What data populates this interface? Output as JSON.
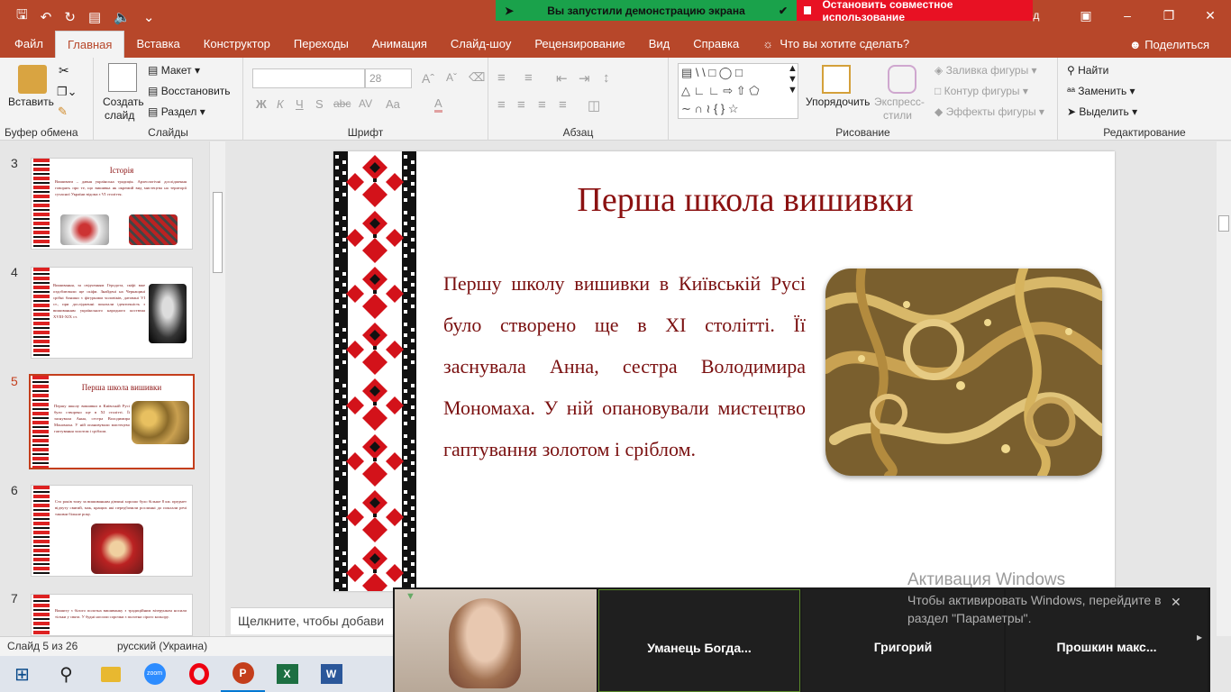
{
  "titlebar": {
    "share_banner": "Вы запустили демонстрацию экрана",
    "stop_share": "Остановить совместное использование",
    "partial_text": "од"
  },
  "tabs": [
    {
      "label": "Файл"
    },
    {
      "label": "Главная",
      "active": true
    },
    {
      "label": "Вставка"
    },
    {
      "label": "Конструктор"
    },
    {
      "label": "Переходы"
    },
    {
      "label": "Анимация"
    },
    {
      "label": "Слайд-шоу"
    },
    {
      "label": "Рецензирование"
    },
    {
      "label": "Вид"
    },
    {
      "label": "Справка"
    }
  ],
  "tell_me": "Что вы хотите сделать?",
  "share_label": "Поделиться",
  "ribbon": {
    "clipboard": {
      "paste": "Вставить",
      "group": "Буфер обмена"
    },
    "slides": {
      "new_slide_1": "Создать",
      "new_slide_2": "слайд",
      "layout": "Макет",
      "reset": "Восстановить",
      "section": "Раздел",
      "group": "Слайды"
    },
    "font": {
      "size": "28",
      "group": "Шрифт",
      "bold": "Ж",
      "italic": "К",
      "underline": "Ч",
      "strike": "S",
      "spacing": "AV",
      "case": "Aa",
      "color": "A"
    },
    "paragraph": {
      "group": "Абзац"
    },
    "drawing": {
      "arrange": "Упорядочить",
      "quick_styles_1": "Экспресс-",
      "quick_styles_2": "стили",
      "fill": "Заливка фигуры",
      "outline": "Контур фигуры",
      "effects": "Эффекты фигуры",
      "group": "Рисование"
    },
    "editing": {
      "find": "Найти",
      "replace": "Заменить",
      "select": "Выделить",
      "group": "Редактирование"
    }
  },
  "thumbnails": [
    {
      "num": "3",
      "title": "Історія",
      "text": "Вишивати – давня українська традиція. Археологічні дослідження говорять про те, що вишивка як окремий вид мистецтва на території сучасної України відома з VI століття."
    },
    {
      "num": "4",
      "title": "",
      "text": "Вишивання, за свідченням Геродота, скіфі вже оздоблювали ще скіфи. Знайдені на Черкащині срібні бляшки з фігурками чоловіків, датовані VI ст., при дослідженні показали ідентичність з вишиванням українського народного костюма XVIII-XIX ст."
    },
    {
      "num": "5",
      "title": "Перша школа вишивки",
      "text": "Першу школу вишивки в Київській Русі було створено ще в XI столітті. Її заснувала Анна, сестра Володимира Мономаха. У ній опановували мистецтво гаптування золотом і сріблом.",
      "selected": true
    },
    {
      "num": "6",
      "title": "",
      "text": "Сто років тому за вишиванням дівчині хорошо було більше 8 км. предмет відчуту святий, мак, кращих які передбачили рослинні до поклали речі такими більше року."
    },
    {
      "num": "7",
      "title": "",
      "text": "Вишиту з білого полотна вишиванку з традиційним візерунком носили тільки у свята. У будні носили сорочки з полотна сірого кольору."
    }
  ],
  "slide": {
    "title": "Перша школа вишивки",
    "body": "Першу школу вишивки в Київській Русі було створено ще в XI столітті. Її заснувала Анна, сестра Володимира Мономаха. У ній опановували мистецтво гаптування золотом і сріблом."
  },
  "notes_placeholder": "Щелкните, чтобы добави",
  "activation": {
    "title": "Активация Windows",
    "text": "Чтобы активировать Windows, перейдите в раздел \"Параметры\"."
  },
  "status": {
    "slide": "Слайд 5 из 26",
    "language": "русский (Украина)"
  },
  "zoom_tiles": [
    {
      "name": ""
    },
    {
      "name": "Уманець Богда..."
    },
    {
      "name": "Григорий"
    },
    {
      "name": "Прошкин макс..."
    }
  ],
  "taskbar": [
    "windows-icon",
    "search-icon",
    "explorer-icon",
    "zoom-icon",
    "opera-icon",
    "powerpoint-icon",
    "excel-icon",
    "word-icon"
  ],
  "colors": {
    "accent": "#b7472a",
    "slide_title": "#8b1111",
    "share_green": "#1aa24b",
    "stop_red": "#e81123"
  }
}
